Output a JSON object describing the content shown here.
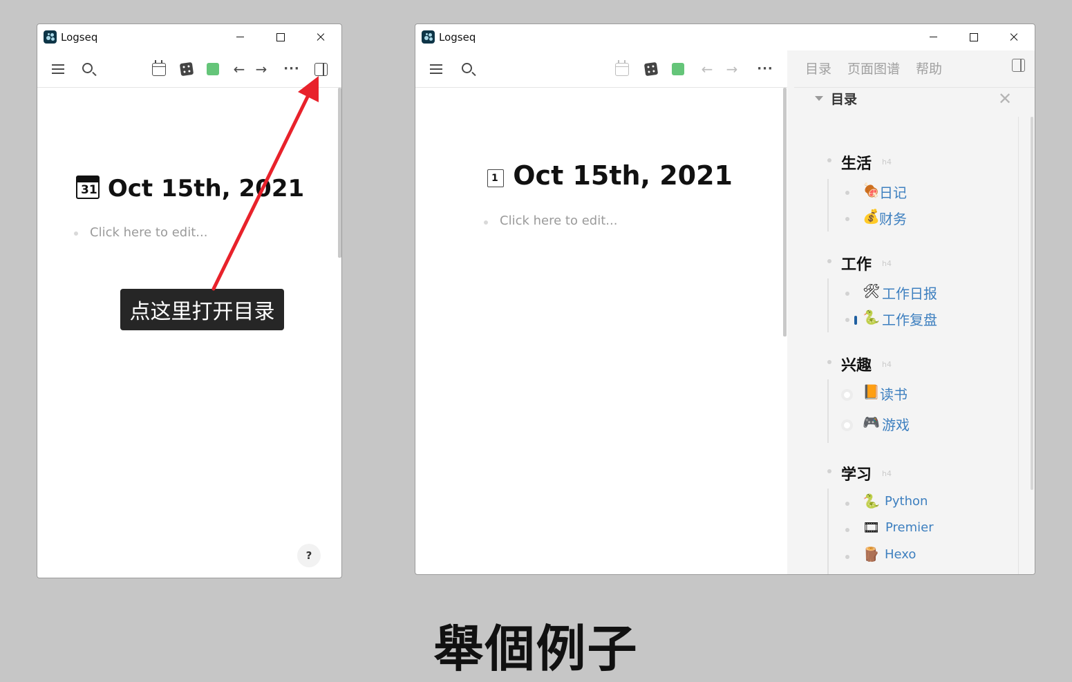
{
  "windows": {
    "left": {
      "app_title": "Logseq",
      "page_title": "Oct 15th, 2021",
      "date_icon_text": "31",
      "edit_placeholder": "Click here to edit...",
      "help_label": "?"
    },
    "right": {
      "app_title": "Logseq",
      "page_title": "Oct 15th, 2021",
      "date_icon_text": "1",
      "edit_placeholder": "Click here to edit..."
    }
  },
  "tooltip": {
    "text": "点这里打开目录"
  },
  "right_sidebar": {
    "tabs": [
      "目录",
      "页面图谱",
      "帮助"
    ],
    "section_title": "目录",
    "close_glyph": "✕",
    "toc": [
      {
        "heading": "生活",
        "tag": "h4",
        "items": [
          {
            "emoji": "🍖",
            "label": "日记"
          },
          {
            "emoji": "💰",
            "label": "财务"
          }
        ]
      },
      {
        "heading": "工作",
        "tag": "h4",
        "items": [
          {
            "emoji": "🛠",
            "label": "工作日报"
          },
          {
            "emoji": "🐍",
            "label": "工作复盘"
          }
        ]
      },
      {
        "heading": "兴趣",
        "tag": "h4",
        "items": [
          {
            "emoji": "📙",
            "label": "读书"
          },
          {
            "emoji": "🎮",
            "label": "游戏"
          }
        ]
      },
      {
        "heading": "学习",
        "tag": "h4",
        "items": [
          {
            "emoji": "🐍",
            "label": "Python"
          },
          {
            "emoji": "🎞",
            "label": "Premier"
          },
          {
            "emoji": "🪵",
            "label": "Hexo"
          }
        ]
      }
    ]
  },
  "toolbar_icons": [
    "menu-icon",
    "search-icon",
    "calendar-icon",
    "dice-icon",
    "green-square-icon",
    "arrow-left-icon",
    "arrow-right-icon",
    "more-icon",
    "sidebar-toggle-icon"
  ],
  "colors": {
    "accent_link": "#3d7fbf",
    "tooltip_bg": "#262626",
    "arrow_red": "#e8222b",
    "green": "#65c579"
  },
  "caption": "舉個例子"
}
